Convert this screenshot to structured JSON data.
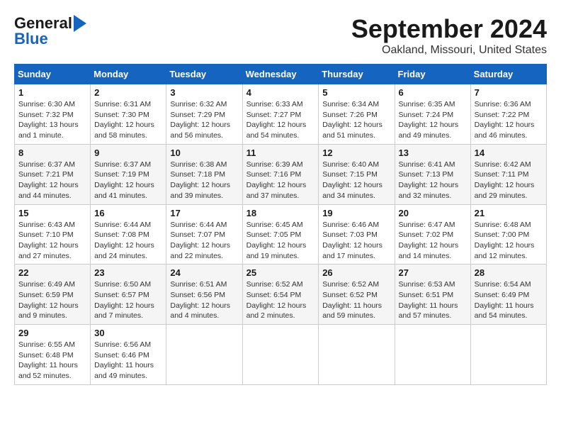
{
  "header": {
    "logo_general": "General",
    "logo_blue": "Blue",
    "month_title": "September 2024",
    "location": "Oakland, Missouri, United States"
  },
  "weekdays": [
    "Sunday",
    "Monday",
    "Tuesday",
    "Wednesday",
    "Thursday",
    "Friday",
    "Saturday"
  ],
  "weeks": [
    [
      {
        "day": "1",
        "sunrise": "Sunrise: 6:30 AM",
        "sunset": "Sunset: 7:32 PM",
        "daylight": "Daylight: 13 hours and 1 minute."
      },
      {
        "day": "2",
        "sunrise": "Sunrise: 6:31 AM",
        "sunset": "Sunset: 7:30 PM",
        "daylight": "Daylight: 12 hours and 58 minutes."
      },
      {
        "day": "3",
        "sunrise": "Sunrise: 6:32 AM",
        "sunset": "Sunset: 7:29 PM",
        "daylight": "Daylight: 12 hours and 56 minutes."
      },
      {
        "day": "4",
        "sunrise": "Sunrise: 6:33 AM",
        "sunset": "Sunset: 7:27 PM",
        "daylight": "Daylight: 12 hours and 54 minutes."
      },
      {
        "day": "5",
        "sunrise": "Sunrise: 6:34 AM",
        "sunset": "Sunset: 7:26 PM",
        "daylight": "Daylight: 12 hours and 51 minutes."
      },
      {
        "day": "6",
        "sunrise": "Sunrise: 6:35 AM",
        "sunset": "Sunset: 7:24 PM",
        "daylight": "Daylight: 12 hours and 49 minutes."
      },
      {
        "day": "7",
        "sunrise": "Sunrise: 6:36 AM",
        "sunset": "Sunset: 7:22 PM",
        "daylight": "Daylight: 12 hours and 46 minutes."
      }
    ],
    [
      {
        "day": "8",
        "sunrise": "Sunrise: 6:37 AM",
        "sunset": "Sunset: 7:21 PM",
        "daylight": "Daylight: 12 hours and 44 minutes."
      },
      {
        "day": "9",
        "sunrise": "Sunrise: 6:37 AM",
        "sunset": "Sunset: 7:19 PM",
        "daylight": "Daylight: 12 hours and 41 minutes."
      },
      {
        "day": "10",
        "sunrise": "Sunrise: 6:38 AM",
        "sunset": "Sunset: 7:18 PM",
        "daylight": "Daylight: 12 hours and 39 minutes."
      },
      {
        "day": "11",
        "sunrise": "Sunrise: 6:39 AM",
        "sunset": "Sunset: 7:16 PM",
        "daylight": "Daylight: 12 hours and 37 minutes."
      },
      {
        "day": "12",
        "sunrise": "Sunrise: 6:40 AM",
        "sunset": "Sunset: 7:15 PM",
        "daylight": "Daylight: 12 hours and 34 minutes."
      },
      {
        "day": "13",
        "sunrise": "Sunrise: 6:41 AM",
        "sunset": "Sunset: 7:13 PM",
        "daylight": "Daylight: 12 hours and 32 minutes."
      },
      {
        "day": "14",
        "sunrise": "Sunrise: 6:42 AM",
        "sunset": "Sunset: 7:11 PM",
        "daylight": "Daylight: 12 hours and 29 minutes."
      }
    ],
    [
      {
        "day": "15",
        "sunrise": "Sunrise: 6:43 AM",
        "sunset": "Sunset: 7:10 PM",
        "daylight": "Daylight: 12 hours and 27 minutes."
      },
      {
        "day": "16",
        "sunrise": "Sunrise: 6:44 AM",
        "sunset": "Sunset: 7:08 PM",
        "daylight": "Daylight: 12 hours and 24 minutes."
      },
      {
        "day": "17",
        "sunrise": "Sunrise: 6:44 AM",
        "sunset": "Sunset: 7:07 PM",
        "daylight": "Daylight: 12 hours and 22 minutes."
      },
      {
        "day": "18",
        "sunrise": "Sunrise: 6:45 AM",
        "sunset": "Sunset: 7:05 PM",
        "daylight": "Daylight: 12 hours and 19 minutes."
      },
      {
        "day": "19",
        "sunrise": "Sunrise: 6:46 AM",
        "sunset": "Sunset: 7:03 PM",
        "daylight": "Daylight: 12 hours and 17 minutes."
      },
      {
        "day": "20",
        "sunrise": "Sunrise: 6:47 AM",
        "sunset": "Sunset: 7:02 PM",
        "daylight": "Daylight: 12 hours and 14 minutes."
      },
      {
        "day": "21",
        "sunrise": "Sunrise: 6:48 AM",
        "sunset": "Sunset: 7:00 PM",
        "daylight": "Daylight: 12 hours and 12 minutes."
      }
    ],
    [
      {
        "day": "22",
        "sunrise": "Sunrise: 6:49 AM",
        "sunset": "Sunset: 6:59 PM",
        "daylight": "Daylight: 12 hours and 9 minutes."
      },
      {
        "day": "23",
        "sunrise": "Sunrise: 6:50 AM",
        "sunset": "Sunset: 6:57 PM",
        "daylight": "Daylight: 12 hours and 7 minutes."
      },
      {
        "day": "24",
        "sunrise": "Sunrise: 6:51 AM",
        "sunset": "Sunset: 6:56 PM",
        "daylight": "Daylight: 12 hours and 4 minutes."
      },
      {
        "day": "25",
        "sunrise": "Sunrise: 6:52 AM",
        "sunset": "Sunset: 6:54 PM",
        "daylight": "Daylight: 12 hours and 2 minutes."
      },
      {
        "day": "26",
        "sunrise": "Sunrise: 6:52 AM",
        "sunset": "Sunset: 6:52 PM",
        "daylight": "Daylight: 11 hours and 59 minutes."
      },
      {
        "day": "27",
        "sunrise": "Sunrise: 6:53 AM",
        "sunset": "Sunset: 6:51 PM",
        "daylight": "Daylight: 11 hours and 57 minutes."
      },
      {
        "day": "28",
        "sunrise": "Sunrise: 6:54 AM",
        "sunset": "Sunset: 6:49 PM",
        "daylight": "Daylight: 11 hours and 54 minutes."
      }
    ],
    [
      {
        "day": "29",
        "sunrise": "Sunrise: 6:55 AM",
        "sunset": "Sunset: 6:48 PM",
        "daylight": "Daylight: 11 hours and 52 minutes."
      },
      {
        "day": "30",
        "sunrise": "Sunrise: 6:56 AM",
        "sunset": "Sunset: 6:46 PM",
        "daylight": "Daylight: 11 hours and 49 minutes."
      },
      null,
      null,
      null,
      null,
      null
    ]
  ]
}
